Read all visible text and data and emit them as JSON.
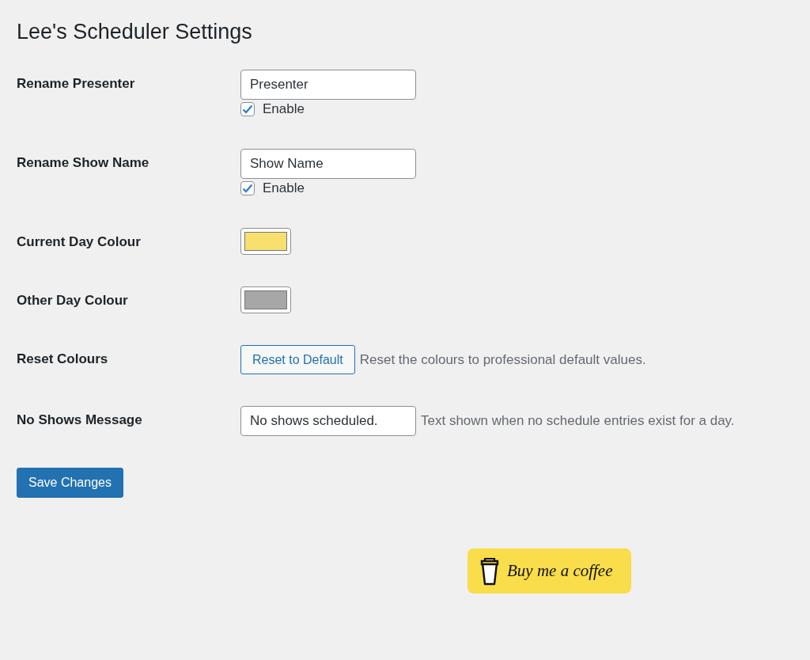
{
  "title": "Lee's Scheduler Settings",
  "settings": [
    {
      "kind": "text",
      "label": "Rename Presenter",
      "value": "Presenter",
      "checkbox": {
        "label": "Enable",
        "checked": true
      }
    },
    {
      "kind": "text",
      "label": "Rename Show Name",
      "value": "Show Name",
      "checkbox": {
        "label": "Enable",
        "checked": true
      }
    },
    {
      "kind": "color",
      "label": "Current Day Colour",
      "color": "#f7e06e"
    },
    {
      "kind": "color",
      "label": "Other Day Colour",
      "color": "#a7a7a7"
    },
    {
      "kind": "button",
      "label": "Reset Colours",
      "button": "Reset to Default",
      "description": "Reset the colours to professional default values."
    },
    {
      "kind": "text",
      "label": "No Shows Message",
      "value": "No shows scheduled.",
      "description": "Text shown when no schedule entries exist for a day."
    }
  ],
  "save_button": "Save Changes",
  "coffee_button": "Buy me a coffee"
}
